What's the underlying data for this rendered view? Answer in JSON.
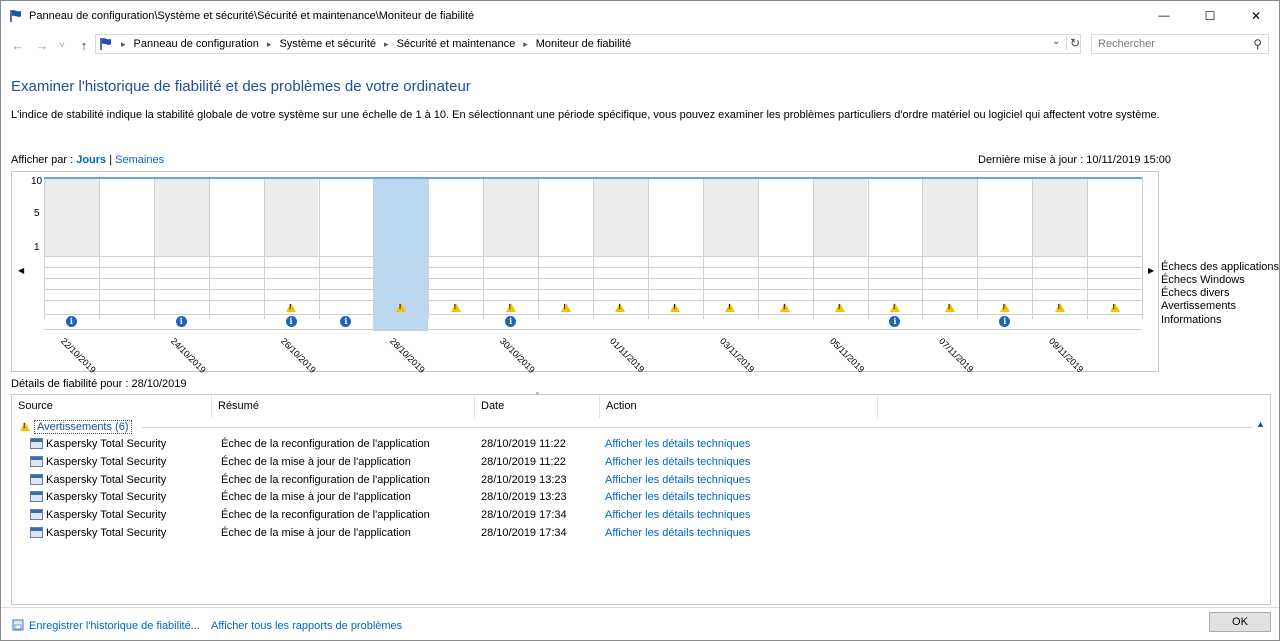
{
  "window": {
    "title": "Panneau de configuration\\Système et sécurité\\Sécurité et maintenance\\Moniteur de fiabilité",
    "minimize_glyph": "—",
    "maximize_glyph": "☐",
    "close_glyph": "✕"
  },
  "nav": {
    "back_glyph": "←",
    "forward_glyph": "→",
    "recent_glyph": "˅",
    "up_glyph": "↑",
    "breadcrumbs": [
      "Panneau de configuration",
      "Système et sécurité",
      "Sécurité et maintenance",
      "Moniteur de fiabilité"
    ],
    "search_placeholder": "Rechercher"
  },
  "header": {
    "title": "Examiner l'historique de fiabilité et des problèmes de votre ordinateur",
    "description": "L'indice de stabilité indique la stabilité globale de votre système sur une échelle de 1 à 10. En sélectionnant une période spécifique, vous pouvez examiner les problèmes particuliers d'ordre matériel ou logiciel qui affectent votre système.",
    "view_by_prefix": "Afficher par : ",
    "view_days": "Jours",
    "view_sep": " | ",
    "view_weeks": "Semaines",
    "last_update": "Dernière mise à jour : 10/11/2019 15:00"
  },
  "chart_data": {
    "type": "table",
    "y_ticks": [
      "10",
      "5",
      "1"
    ],
    "stability_index": 10,
    "selected_column": 6,
    "row_labels": [
      "Échecs des applications",
      "Échecs Windows",
      "Échecs divers",
      "Avertissements",
      "Informations"
    ],
    "date_labels": [
      "22/10/2019",
      "24/10/2019",
      "26/10/2019",
      "28/10/2019",
      "30/10/2019",
      "01/11/2019",
      "03/11/2019",
      "05/11/2019",
      "07/11/2019",
      "09/11/2019"
    ],
    "warnings": [
      false,
      false,
      false,
      false,
      true,
      false,
      true,
      true,
      true,
      true,
      true,
      true,
      true,
      true,
      true,
      true,
      true,
      true,
      true,
      true
    ],
    "informations": [
      true,
      false,
      true,
      false,
      true,
      true,
      false,
      false,
      true,
      false,
      false,
      false,
      false,
      false,
      false,
      true,
      false,
      true,
      false,
      false
    ],
    "colors": {
      "shaded": "#ececec",
      "selected": "#bcd8f0",
      "line": "#6aa5dc"
    }
  },
  "details": {
    "title": "Détails de fiabilité pour : 28/10/2019",
    "columns": [
      "Source",
      "Résumé",
      "Date",
      "Action"
    ],
    "group_label": "Avertissements (6)",
    "rows": [
      {
        "source": "Kaspersky Total Security",
        "summary": "Échec de la reconfiguration de l'application",
        "date": "28/10/2019 11:22",
        "action": "Afficher les détails techniques"
      },
      {
        "source": "Kaspersky Total Security",
        "summary": "Échec de la mise à jour de l'application",
        "date": "28/10/2019 11:22",
        "action": "Afficher les détails techniques"
      },
      {
        "source": "Kaspersky Total Security",
        "summary": "Échec de la reconfiguration de l'application",
        "date": "28/10/2019 13:23",
        "action": "Afficher les détails techniques"
      },
      {
        "source": "Kaspersky Total Security",
        "summary": "Échec de la mise à jour de l'application",
        "date": "28/10/2019 13:23",
        "action": "Afficher les détails techniques"
      },
      {
        "source": "Kaspersky Total Security",
        "summary": "Échec de la reconfiguration de l'application",
        "date": "28/10/2019 17:34",
        "action": "Afficher les détails techniques"
      },
      {
        "source": "Kaspersky Total Security",
        "summary": "Échec de la mise à jour de l'application",
        "date": "28/10/2019 17:34",
        "action": "Afficher les détails techniques"
      }
    ]
  },
  "footer": {
    "save_history": "Enregistrer l'historique de fiabilité...",
    "view_all_reports": "Afficher tous les rapports de problèmes",
    "ok": "OK"
  }
}
